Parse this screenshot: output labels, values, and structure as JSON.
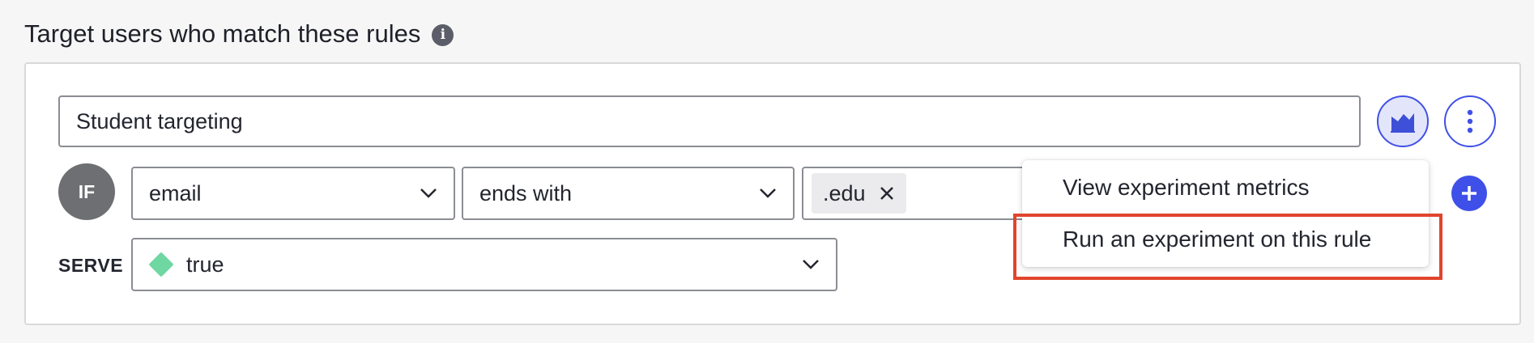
{
  "section": {
    "title": "Target users who match these rules",
    "info_icon": "info-icon"
  },
  "rule": {
    "name": "Student targeting",
    "if_label": "IF",
    "clause": {
      "attribute": "email",
      "operator": "ends with",
      "values": [
        ".edu"
      ]
    },
    "serve_label": "SERVE",
    "serve_value": "true",
    "serve_color": "#6fd7a2"
  },
  "menu": {
    "items": [
      {
        "label": "View experiment metrics"
      },
      {
        "label": "Run an experiment on this rule"
      }
    ],
    "highlighted_item": "Run an experiment on this rule",
    "highlight_color": "#e0452d"
  },
  "colors": {
    "accent": "#4050e6",
    "badge_bg": "#6e6f73"
  }
}
